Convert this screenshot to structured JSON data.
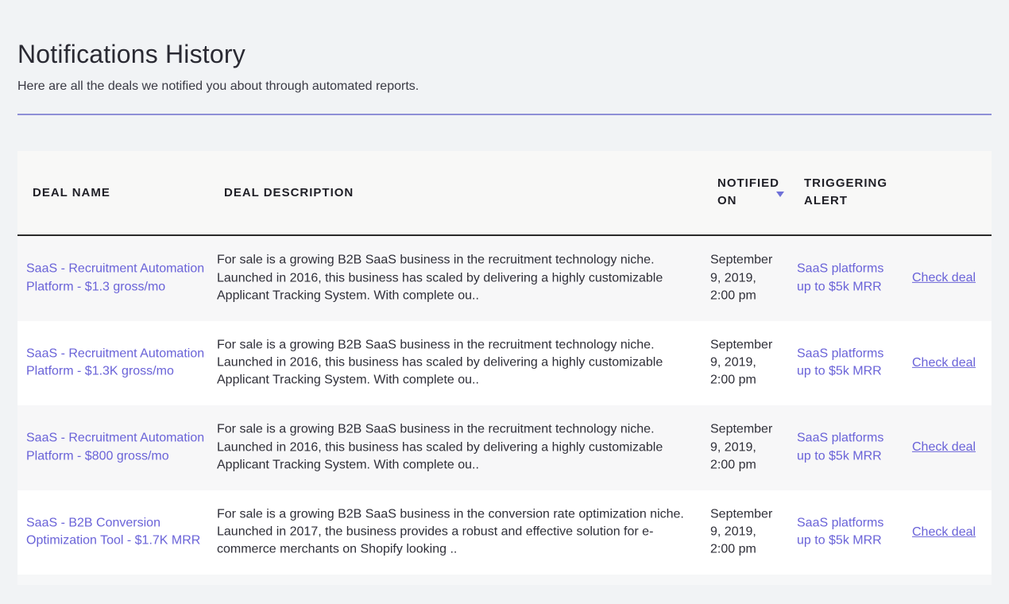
{
  "page": {
    "title": "Notifications History",
    "subtitle": "Here are all the deals we notified you about through automated reports."
  },
  "table": {
    "columns": {
      "deal_name": "DEAL NAME",
      "deal_description": "DEAL DESCRIPTION",
      "notified_on": "NOTIFIED ON",
      "triggering_alert": "TRIGGERING ALERT"
    },
    "sort": {
      "column": "notified_on",
      "direction": "descending",
      "icon": "caret-down-icon"
    },
    "rows": [
      {
        "name": "SaaS - Recruitment Automation Platform - $1.3 gross/mo",
        "description": "For sale is a growing B2B SaaS business in the recruitment technology niche. Launched in 2016, this business has scaled by delivering a highly customizable Applicant Tracking System. With complete ou..",
        "notified_on": "September 9, 2019, 2:00 pm",
        "alert": "SaaS platforms up to $5k MRR",
        "action": "Check deal"
      },
      {
        "name": "SaaS - Recruitment Automation Platform - $1.3K gross/mo",
        "description": "For sale is a growing B2B SaaS business in the recruitment technology niche. Launched in 2016, this business has scaled by delivering a highly customizable Applicant Tracking System. With complete ou..",
        "notified_on": "September 9, 2019, 2:00 pm",
        "alert": "SaaS platforms up to $5k MRR",
        "action": "Check deal"
      },
      {
        "name": "SaaS - Recruitment Automation Platform - $800 gross/mo",
        "description": "For sale is a growing B2B SaaS business in the recruitment technology niche. Launched in 2016, this business has scaled by delivering a highly customizable Applicant Tracking System. With complete ou..",
        "notified_on": "September 9, 2019, 2:00 pm",
        "alert": "SaaS platforms up to $5k MRR",
        "action": "Check deal"
      },
      {
        "name": "SaaS - B2B Conversion Optimization Tool - $1.7K MRR",
        "description": "For sale is a growing B2B SaaS business in the conversion rate optimization niche. Launched in 2017, the business provides a robust and effective solution for e-commerce merchants on Shopify looking ..",
        "notified_on": "September 9, 2019, 2:00 pm",
        "alert": "SaaS platforms up to $5k MRR",
        "action": "Check deal"
      }
    ]
  },
  "colors": {
    "accent": "#6a63d8",
    "divider": "#8e8fd6",
    "page_background": "#f1f3f5"
  }
}
